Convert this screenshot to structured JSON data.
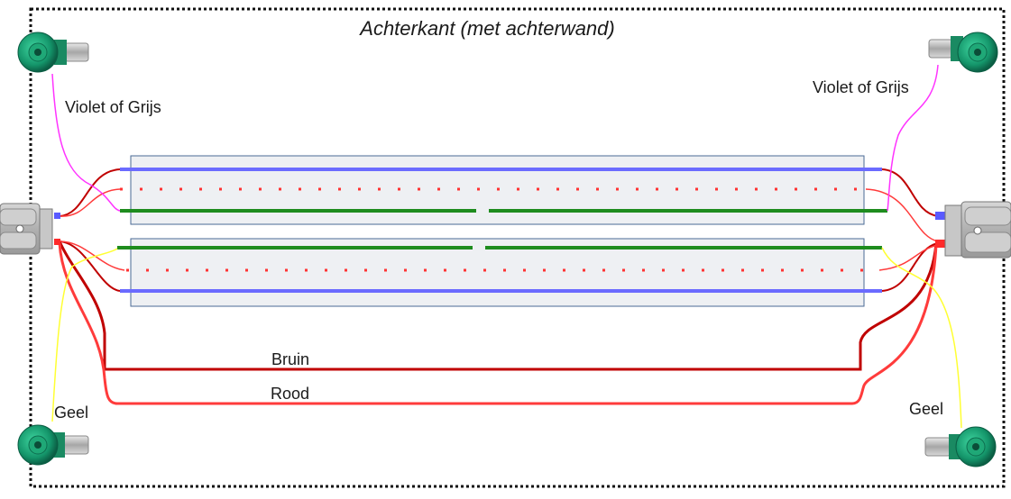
{
  "title": "Achterkant (met achterwand)",
  "labels": {
    "violet_left": "Violet of Grijs",
    "violet_right": "Violet of Grijs",
    "geel_left": "Geel",
    "geel_right": "Geel",
    "bruin": "Bruin",
    "rood": "Rood"
  },
  "colors": {
    "blue": "#6b6bff",
    "green": "#1e8c1e",
    "red_dots": "#ff3333",
    "dark_red": "#c00000",
    "red": "#ff3b3b",
    "magenta": "#ff33ff",
    "yellow": "#ffff33",
    "tube_fill": "#eef0f3",
    "tube_border": "#4a6a96",
    "terminal_green": "#1a9a6e"
  },
  "icons": [
    "terminal-post-icon",
    "connector-plug-icon"
  ]
}
